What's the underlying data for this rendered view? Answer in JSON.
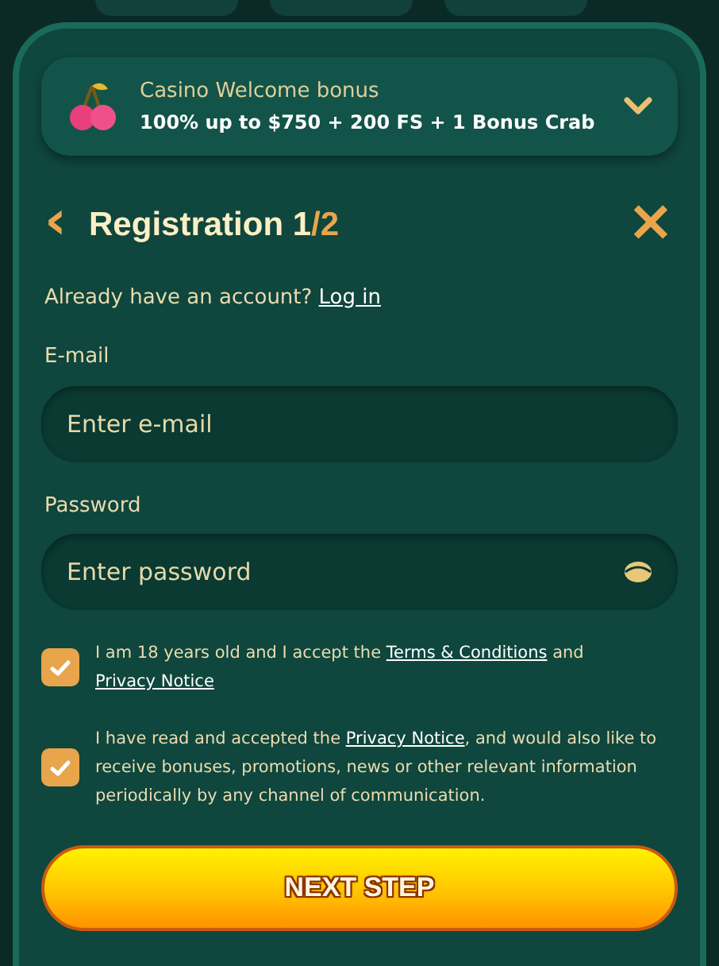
{
  "bonus": {
    "title": "Casino Welcome bonus",
    "offer": "100% up to $750 + 200 FS + 1 Bonus Crab",
    "expanded": false
  },
  "header": {
    "back": "‹",
    "title": "Registration 1",
    "title_accent": "/2",
    "close": "×"
  },
  "login_prompt": {
    "text": "Already have an account?",
    "link": "Log in"
  },
  "fields": [
    {
      "label": "E-mail",
      "placeholder": "Enter e-mail",
      "kind": "email"
    },
    {
      "label": "Password",
      "placeholder": "Enter password",
      "kind": "password"
    }
  ],
  "consents": [
    {
      "checked": true,
      "parts": [
        {
          "text": "I am 18 years old and I accept the ",
          "link": false
        },
        {
          "text": "Terms & Conditions",
          "link": true
        },
        {
          "text": " and ",
          "link": false
        },
        {
          "text": "Privacy Notice",
          "link": true
        }
      ]
    },
    {
      "checked": true,
      "parts": [
        {
          "text": "I have read and accepted the ",
          "link": false
        },
        {
          "text": "Privacy Notice",
          "link": true
        },
        {
          "text": ", and would also like to receive bonuses, promotions, news or other relevant information periodically by any channel of communication.",
          "link": false
        }
      ]
    }
  ],
  "submit": "NEXT STEP"
}
